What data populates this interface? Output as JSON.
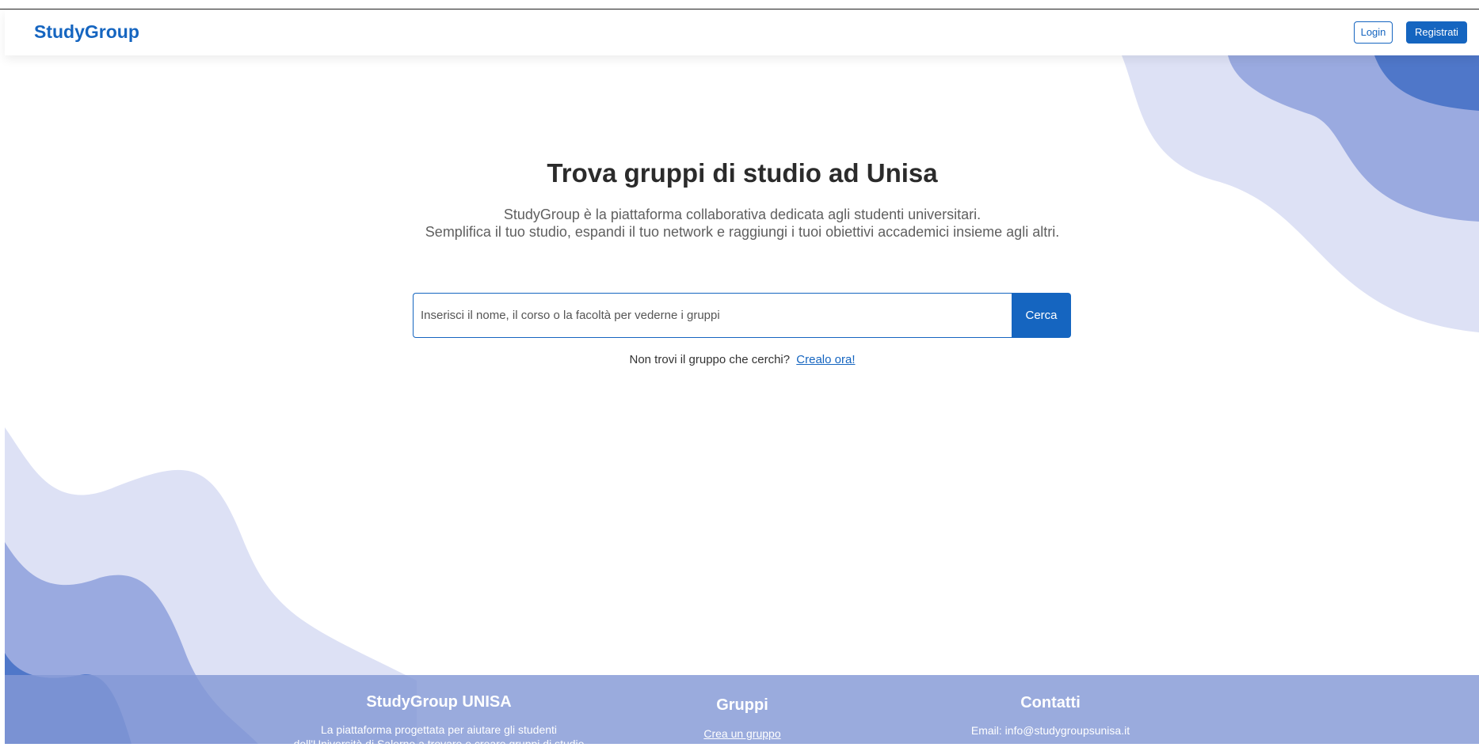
{
  "navbar": {
    "brand": "StudyGroup",
    "login_label": "Login",
    "register_label": "Registrati"
  },
  "hero": {
    "title": "Trova gruppi di studio ad Unisa",
    "subtitle_line1": "StudyGroup è la piattaforma collaborativa dedicata agli studenti universitari.",
    "subtitle_line2": "Semplifica il tuo studio, espandi il tuo network e raggiungi i tuoi obiettivi accademici insieme agli altri."
  },
  "search": {
    "placeholder": "Inserisci il nome, il corso o la facoltà per vederne i gruppi",
    "value": "",
    "button_label": "Cerca"
  },
  "create_prompt": {
    "text": "Non trovi il gruppo che cerchi?",
    "link_label": "Crealo ora!"
  },
  "footer": {
    "about": {
      "heading": "StudyGroup UNISA",
      "line1": "La piattaforma progettata per aiutare gli studenti",
      "line2": "dell'Università di Salerno a trovare e creare gruppi di studio"
    },
    "groups": {
      "heading": "Gruppi",
      "link_create": "Crea un gruppo"
    },
    "contacts": {
      "heading": "Contatti",
      "email": "Email: info@studygroupsunisa.it"
    }
  },
  "colors": {
    "primary": "#1565c0",
    "wave_light": "#dde1f5",
    "wave_mid": "#9aaae0",
    "wave_dark": "#4f77c9"
  }
}
